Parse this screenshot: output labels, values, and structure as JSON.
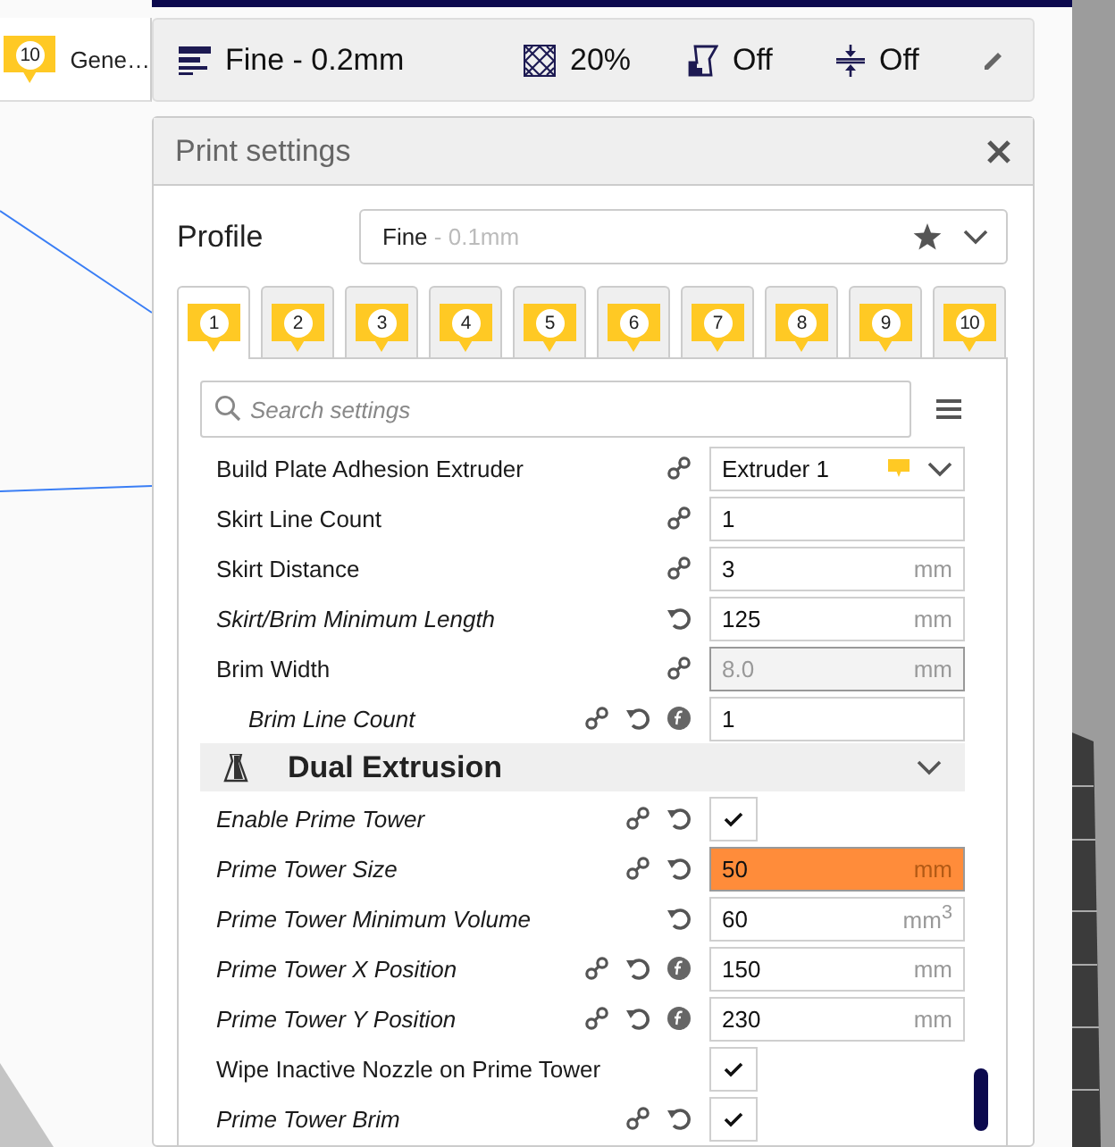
{
  "extruder_tab": {
    "badge": "10",
    "label": "Gene…"
  },
  "top_bar": {
    "profile": "Fine - 0.2mm",
    "infill": "20%",
    "support": "Off",
    "adhesion": "Off"
  },
  "print_settings": {
    "title": "Print settings",
    "profile_label": "Profile",
    "profile": {
      "name": "Fine",
      "detail": "- 0.1mm"
    },
    "tabs": [
      {
        "label": "1",
        "selected": true
      },
      {
        "label": "2",
        "selected": false
      },
      {
        "label": "3",
        "selected": false
      },
      {
        "label": "4",
        "selected": false
      },
      {
        "label": "5",
        "selected": false
      },
      {
        "label": "6",
        "selected": false
      },
      {
        "label": "7",
        "selected": false
      },
      {
        "label": "8",
        "selected": false
      },
      {
        "label": "9",
        "selected": false
      },
      {
        "label": "10",
        "selected": false
      }
    ],
    "search": {
      "placeholder": "Search settings"
    },
    "settings": [
      {
        "kind": "dropdown",
        "label": "Build Plate Adhesion Extruder",
        "modified": false,
        "linked": true,
        "resettable": false,
        "formula": false,
        "value": "Extruder 1"
      },
      {
        "kind": "number",
        "label": "Skirt Line Count",
        "modified": false,
        "linked": true,
        "resettable": false,
        "formula": false,
        "disabled": false,
        "warning": false,
        "value": "1"
      },
      {
        "kind": "number",
        "label": "Skirt Distance",
        "modified": false,
        "linked": true,
        "resettable": false,
        "formula": false,
        "disabled": false,
        "warning": false,
        "value": "3",
        "unit": "mm"
      },
      {
        "kind": "number",
        "label": "Skirt/Brim Minimum Length",
        "modified": true,
        "linked": false,
        "resettable": true,
        "formula": false,
        "disabled": false,
        "warning": false,
        "value": "125",
        "unit": "mm"
      },
      {
        "kind": "number",
        "label": "Brim Width",
        "modified": false,
        "linked": true,
        "resettable": false,
        "formula": false,
        "disabled": true,
        "warning": false,
        "value": "8.0",
        "unit": "mm",
        "children": [
          {
            "kind": "number",
            "label": "Brim Line Count",
            "modified": true,
            "linked": true,
            "resettable": true,
            "formula": true,
            "disabled": false,
            "warning": false,
            "value": "1"
          }
        ]
      },
      {
        "kind": "category",
        "label": "Dual Extrusion",
        "expanded": true
      },
      {
        "kind": "checkbox",
        "label": "Enable Prime Tower",
        "modified": true,
        "linked": true,
        "resettable": true,
        "formula": false,
        "checked": true
      },
      {
        "kind": "number",
        "label": "Prime Tower Size",
        "modified": true,
        "linked": true,
        "resettable": true,
        "formula": false,
        "disabled": false,
        "warning": true,
        "value": "50",
        "unit": "mm"
      },
      {
        "kind": "number",
        "label": "Prime Tower Minimum Volume",
        "modified": true,
        "linked": false,
        "resettable": true,
        "formula": false,
        "disabled": false,
        "warning": false,
        "value": "60",
        "unit": "mm$^{3}$"
      },
      {
        "kind": "number",
        "label": "Prime Tower X Position",
        "modified": true,
        "linked": true,
        "resettable": true,
        "formula": true,
        "disabled": false,
        "warning": false,
        "value": "150",
        "unit": "mm"
      },
      {
        "kind": "number",
        "label": "Prime Tower Y Position",
        "modified": true,
        "linked": true,
        "resettable": true,
        "formula": true,
        "disabled": false,
        "warning": false,
        "value": "230",
        "unit": "mm"
      },
      {
        "kind": "checkbox",
        "label": "Wipe Inactive Nozzle on Prime Tower",
        "modified": false,
        "linked": false,
        "resettable": false,
        "formula": false,
        "checked": true
      },
      {
        "kind": "checkbox",
        "label": "Prime Tower Brim",
        "modified": true,
        "linked": true,
        "resettable": true,
        "formula": false,
        "checked": true
      }
    ]
  }
}
